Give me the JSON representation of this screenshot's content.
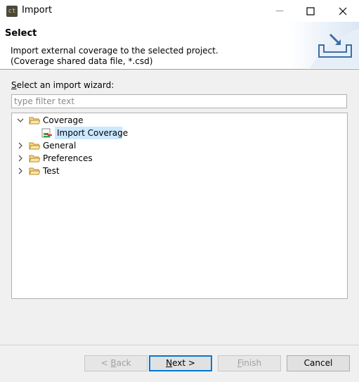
{
  "window": {
    "title": "Import",
    "icon_text": "ct",
    "minimize": "—",
    "maximize": "☐",
    "close": "✕"
  },
  "banner": {
    "title": "Select",
    "description": "Import external coverage to the selected project.\n(Coverage shared data file, *.csd)"
  },
  "wizard": {
    "label_prefix": "S",
    "label_rest": "elect an import wizard:",
    "filter_placeholder": "type filter text",
    "filter_value": ""
  },
  "tree": {
    "items": [
      {
        "label": "Coverage",
        "expanded": true,
        "icon": "folder-open-icon"
      },
      {
        "label": "Import Coverage",
        "selected": true,
        "icon": "coverage-import-icon"
      },
      {
        "label": "General",
        "expanded": false,
        "icon": "folder-open-icon"
      },
      {
        "label": "Preferences",
        "expanded": false,
        "icon": "folder-open-icon"
      },
      {
        "label": "Test",
        "expanded": false,
        "icon": "folder-open-icon"
      }
    ]
  },
  "buttons": {
    "back": {
      "prefix": "< ",
      "mnemonic": "B",
      "rest": "ack"
    },
    "next": {
      "mnemonic": "N",
      "rest": "ext >"
    },
    "finish": {
      "mnemonic": "F",
      "rest": "inish"
    },
    "cancel": "Cancel"
  },
  "colors": {
    "selection": "#cce8ff",
    "default_button_border": "#0078d7",
    "folder": "#e8b44a"
  }
}
